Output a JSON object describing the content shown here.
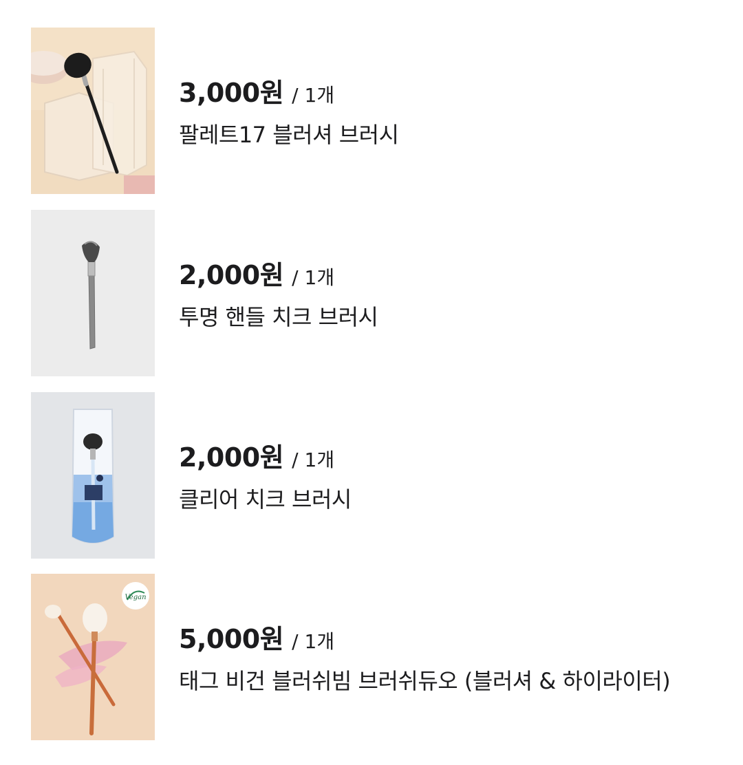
{
  "products": [
    {
      "price": "3,000원",
      "unit": "/ 1개",
      "name": "팔레트17 블러셔 브러시",
      "image_bg": "#f1dcc0"
    },
    {
      "price": "2,000원",
      "unit": "/ 1개",
      "name": "투명 핸들 치크 브러시",
      "image_bg": "#ececec"
    },
    {
      "price": "2,000원",
      "unit": "/ 1개",
      "name": "클리어 치크 브러시",
      "image_bg": "#e3e5e8"
    },
    {
      "price": "5,000원",
      "unit": "/ 1개",
      "name": "태그 비건 블러쉬빔 브러쉬듀오 (블러셔 & 하이라이터)",
      "image_bg": "#f2d7bd",
      "badge": "Vegan"
    }
  ]
}
